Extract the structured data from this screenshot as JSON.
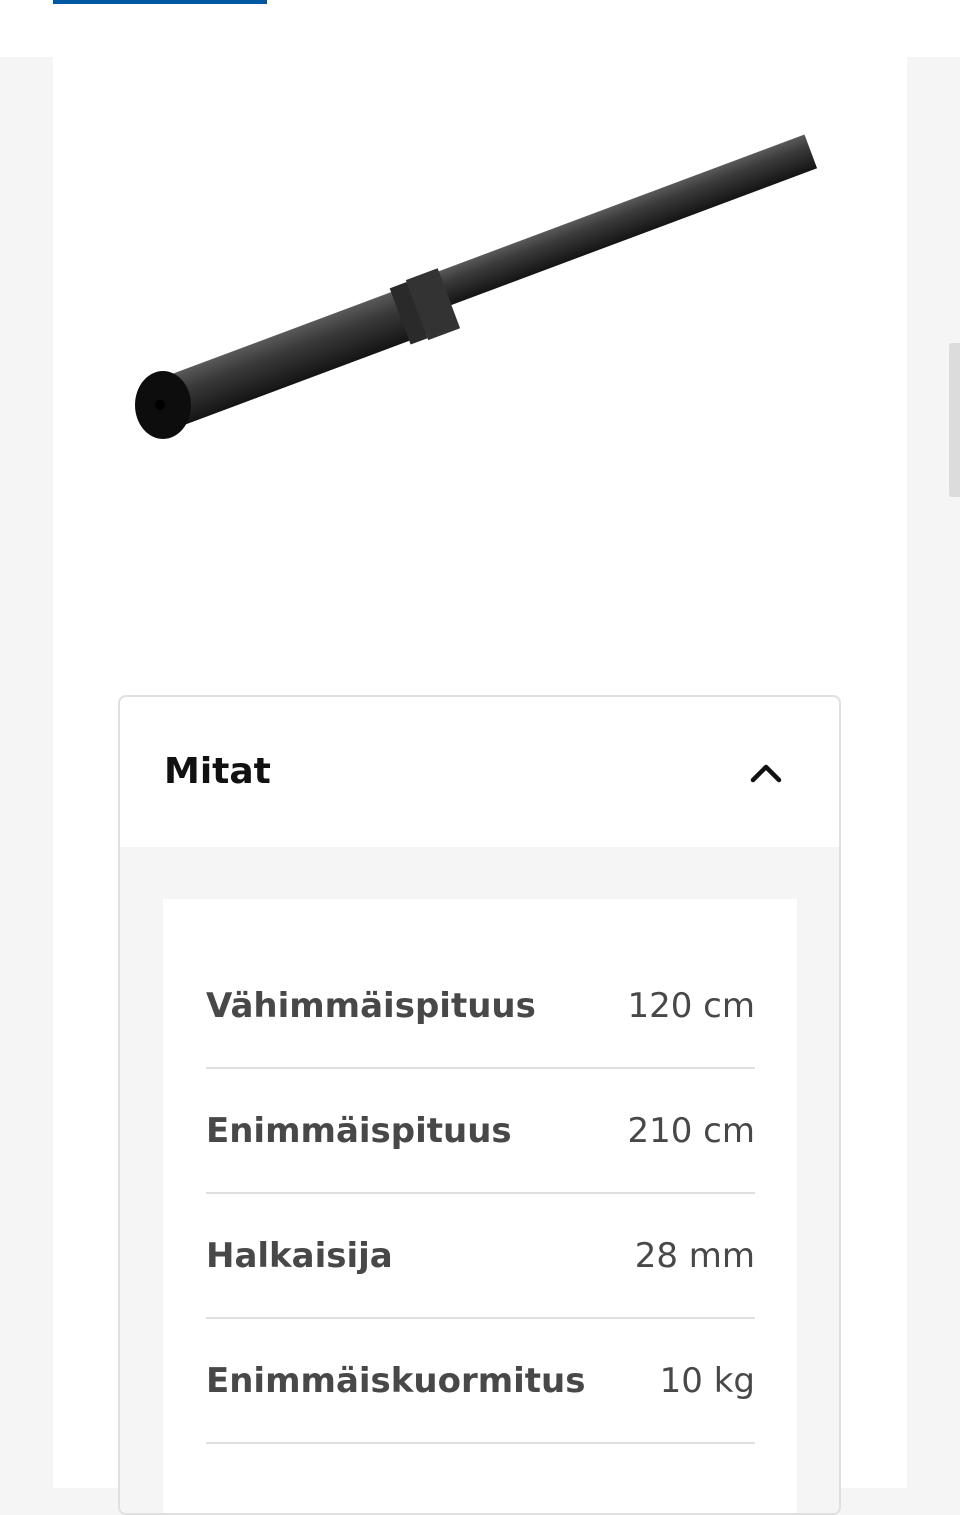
{
  "accordion": {
    "title": "Mitat",
    "expanded": true,
    "rows": [
      {
        "label": "Vähimmäispituus",
        "value": "120 cm"
      },
      {
        "label": "Enimmäispituus",
        "value": "210 cm"
      },
      {
        "label": "Halkaisija",
        "value": "28 mm"
      },
      {
        "label": "Enimmäiskuormitus",
        "value": "10 kg"
      }
    ]
  },
  "icons": {
    "toggle": "chevron-up-icon"
  },
  "colors": {
    "accent": "#0058a3",
    "background": "#f5f5f5",
    "text_dark": "#111111",
    "text_body": "#484848"
  }
}
